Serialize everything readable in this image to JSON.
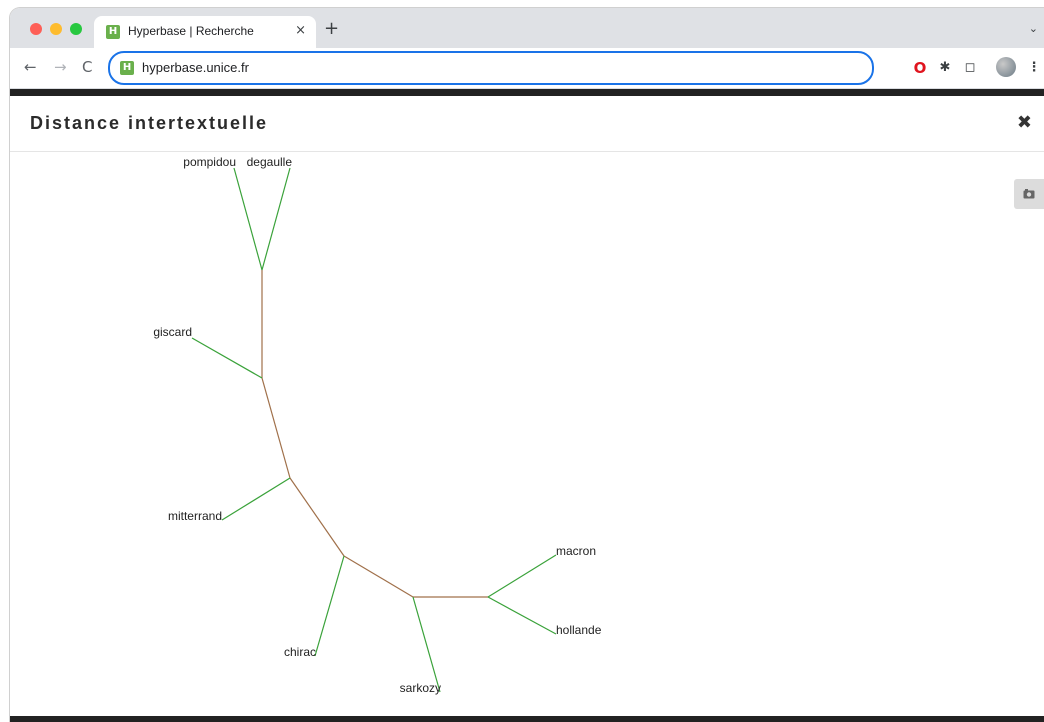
{
  "browser": {
    "tab_title": "Hyperbase | Recherche",
    "tab_favicon": "H",
    "new_tab_label": "+",
    "tab_close": "×",
    "url": "hyperbase.unice.fr",
    "icons": [
      "back-icon",
      "forward-icon",
      "reload-icon",
      "opera-icon",
      "puzzle-icon",
      "sidepanel-icon",
      "avatar-icon",
      "kebab-menu-icon"
    ]
  },
  "modal": {
    "title": "Distance intertextuelle",
    "close_glyph": "✖"
  },
  "tree": {
    "leaves": [
      {
        "id": "pompidou",
        "label": "pompidou"
      },
      {
        "id": "degaulle",
        "label": "degaulle"
      },
      {
        "id": "giscard",
        "label": "giscard"
      },
      {
        "id": "mitterrand",
        "label": "mitterrand"
      },
      {
        "id": "chirac",
        "label": "chirac"
      },
      {
        "id": "sarkozy",
        "label": "sarkozy"
      },
      {
        "id": "macron",
        "label": "macron"
      },
      {
        "id": "hollande",
        "label": "hollande"
      }
    ],
    "colors": {
      "internal_edge": "#a0704a",
      "leaf_edge": "#3aa23a"
    }
  }
}
